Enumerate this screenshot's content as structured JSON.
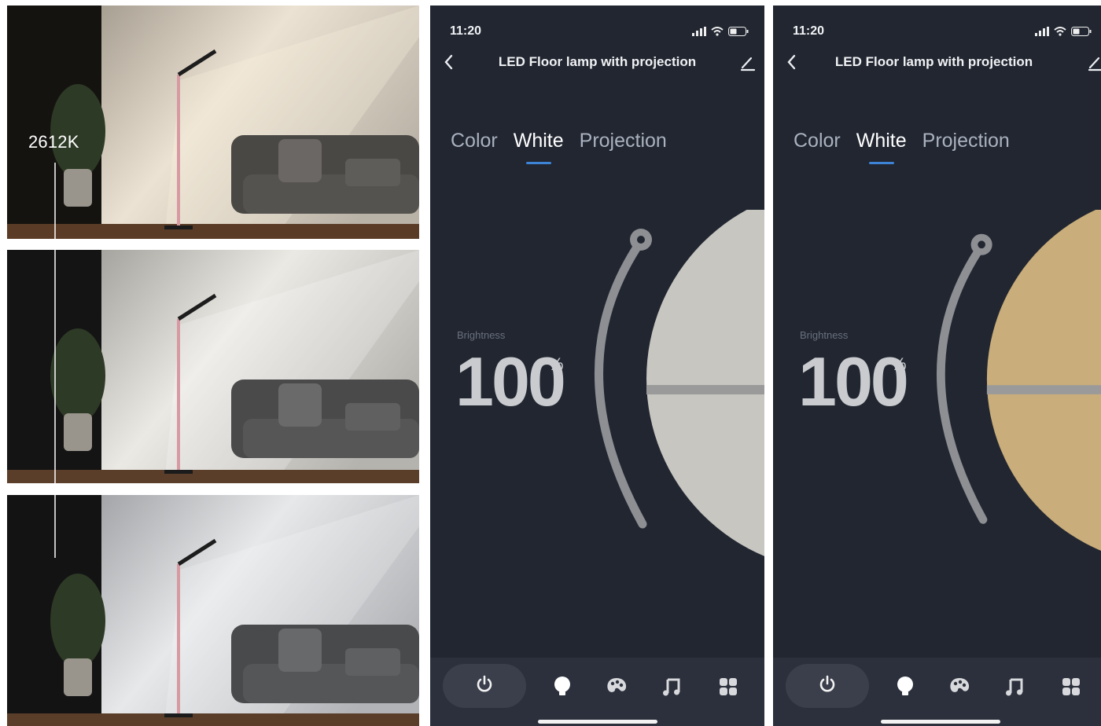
{
  "photos": {
    "temperature_label": "2612K"
  },
  "phones": [
    {
      "status_time": "11:20",
      "title": "LED Floor lamp with projection",
      "tabs": [
        "Color",
        "White",
        "Projection"
      ],
      "active_tab": "White",
      "brightness_label": "Brightness",
      "brightness_value": "100",
      "brightness_unit": "%",
      "dial_color": "#c7c6c1"
    },
    {
      "status_time": "11:20",
      "title": "LED Floor lamp with projection",
      "tabs": [
        "Color",
        "White",
        "Projection"
      ],
      "active_tab": "White",
      "brightness_label": "Brightness",
      "brightness_value": "100",
      "brightness_unit": "%",
      "dial_color": "#c9ad7a"
    }
  ],
  "icons": {
    "back": "chevron-left-icon",
    "edit": "edit-icon",
    "power": "power-icon",
    "white_mode": "bulb-icon",
    "color_mode": "palette-icon",
    "music_mode": "music-icon",
    "scenes": "grid-icon"
  },
  "colors": {
    "app_background": "#212631",
    "accent": "#3d84d7"
  }
}
